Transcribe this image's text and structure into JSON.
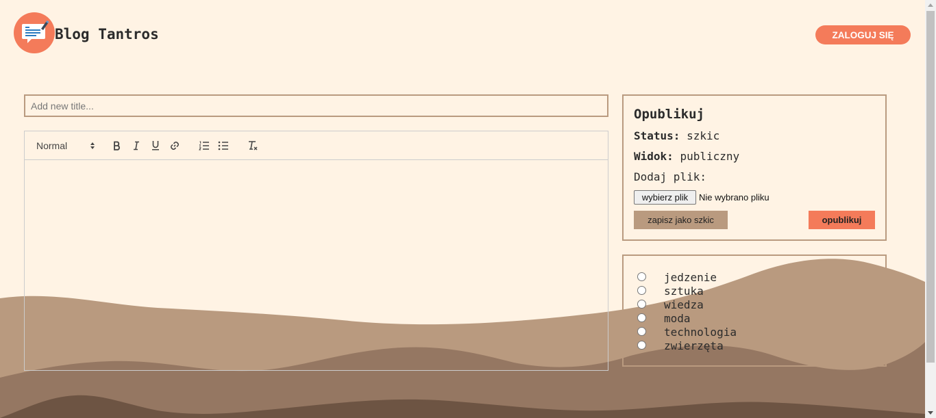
{
  "header": {
    "brand": "Blog Tantros",
    "login_label": "ZALOGUJ SIĘ",
    "logo_icon": "blog-chat-icon"
  },
  "editor": {
    "title_placeholder": "Add new title...",
    "title_value": "",
    "format_label": "Normal",
    "tools": [
      "bold-icon",
      "italic-icon",
      "underline-icon",
      "link-icon",
      "ordered-list-icon",
      "bullet-list-icon",
      "clear-format-icon"
    ]
  },
  "publish": {
    "title": "Opublikuj",
    "status_label": "Status:",
    "status_value": "szkic",
    "view_label": "Widok:",
    "view_value": "publiczny",
    "file_label": "Dodaj plik:",
    "file_button": "wybierz plik",
    "file_status": "Nie wybrano pliku",
    "draft_button": "zapisz jako szkic",
    "publish_button": "opublikuj"
  },
  "categories": [
    "jedzenie",
    "sztuka",
    "wiedza",
    "moda",
    "technologia",
    "zwierzęta"
  ],
  "colors": {
    "background": "#fff3e4",
    "accent": "#f47b5a",
    "tan": "#b99a7f",
    "wave_dark": "#957762",
    "wave_darkest": "#6d5443"
  }
}
